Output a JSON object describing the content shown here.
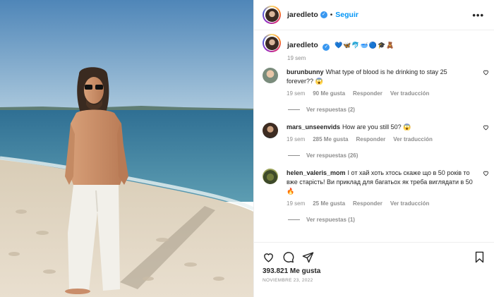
{
  "post": {
    "username": "jaredleto",
    "follow_label": "Seguir",
    "separator": "•",
    "more_label": "•••",
    "caption_emojis": "💙🦋🐬🥣🔵🎓🧸",
    "caption_time": "19 sem"
  },
  "comments": [
    {
      "username": "burunbunny",
      "text": "What type of blood is he drinking to stay 25 forever?? 😱",
      "time": "19 sem",
      "likes": "90 Me gusta",
      "reply_label": "Responder",
      "translate_label": "Ver traducción",
      "replies_label": "Ver respuestas (2)"
    },
    {
      "username": "mars_unseenvids",
      "text": "How are you still 50? 😱",
      "time": "19 sem",
      "likes": "285 Me gusta",
      "reply_label": "Responder",
      "translate_label": "Ver traducción",
      "replies_label": "Ver respuestas (26)"
    },
    {
      "username": "helen_valeris_mom",
      "text": "І от хай хоть хтось скаже що в 50 років то вже старість! Ви приклад для багатьох як треба виглядати в 50🔥",
      "time": "19 sem",
      "likes": "25 Me gusta",
      "reply_label": "Responder",
      "translate_label": "Ver traducción",
      "replies_label": "Ver respuestas (1)"
    }
  ],
  "footer": {
    "likes": "393.821 Me gusta",
    "date": "NOVIEMBRE 23, 2022"
  },
  "colors": {
    "accent": "#0095f6",
    "verified": "#3897f0",
    "muted": "#8e8e8e",
    "text": "#262626"
  },
  "icons": [
    "heart-icon",
    "comment-icon",
    "share-icon",
    "bookmark-icon",
    "verified-icon",
    "more-icon"
  ]
}
